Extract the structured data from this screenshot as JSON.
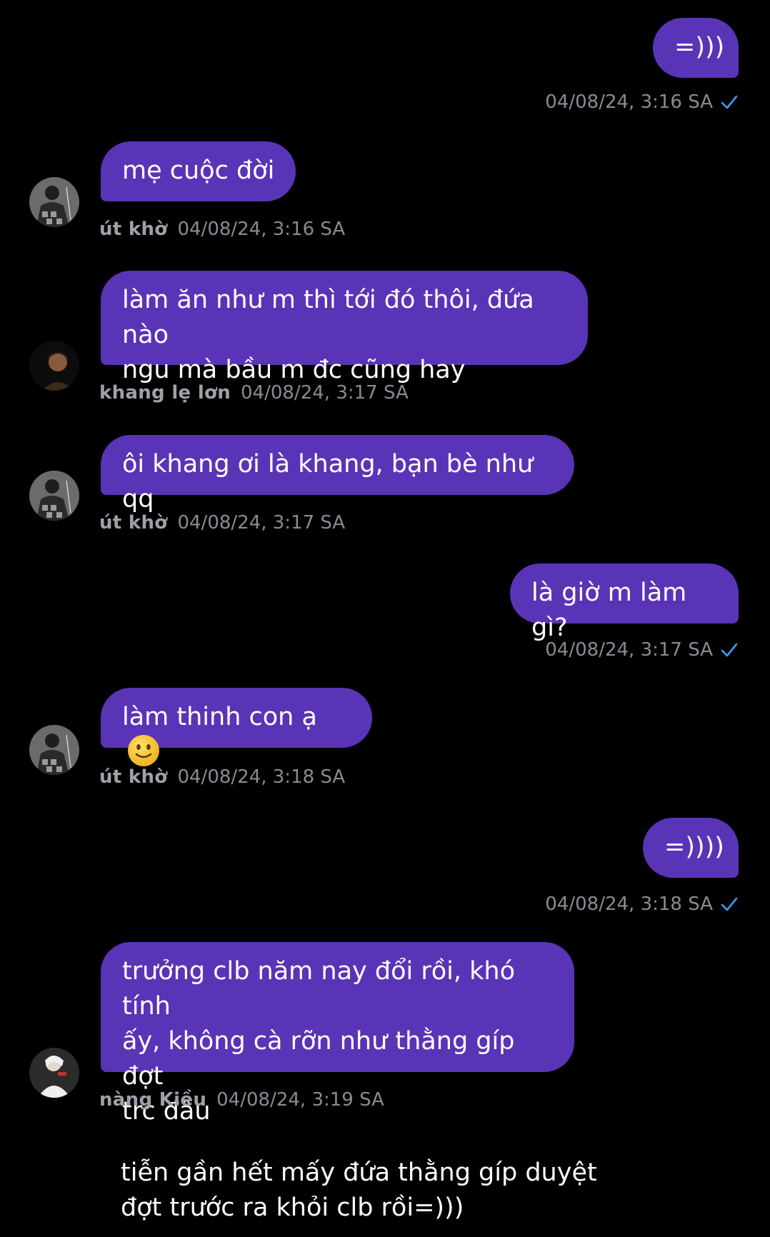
{
  "colors": {
    "background": "#000000",
    "bubble": "#5a34b6",
    "bubble_text": "#ffffff",
    "meta_text": "#8a8a93",
    "sender_text": "#a0a0a8",
    "checkmark": "#3b9cf0"
  },
  "messages": [
    {
      "direction": "out",
      "lines": [
        "=)))"
      ],
      "time": "04/08/24, 3:16 SA",
      "status_icon": "check-icon"
    },
    {
      "direction": "in",
      "sender": "út khờ",
      "avatar": "avatar-ut-kho",
      "lines": [
        "mẹ cuộc đời"
      ],
      "time": "04/08/24, 3:16 SA"
    },
    {
      "direction": "in",
      "sender": "khang lẹ lơn",
      "avatar": "avatar-khang",
      "lines": [
        "làm ăn như m thì tới đó thôi, đứa nào",
        "ngu mà bầu m đc cũng hay"
      ],
      "time": "04/08/24, 3:17 SA"
    },
    {
      "direction": "in",
      "sender": "út khờ",
      "avatar": "avatar-ut-kho",
      "lines": [
        "ôi khang ơi là khang, bạn bè như qq"
      ],
      "time": "04/08/24, 3:17 SA"
    },
    {
      "direction": "out",
      "lines": [
        "là giờ m làm gì?"
      ],
      "time": "04/08/24, 3:17 SA",
      "status_icon": "check-icon"
    },
    {
      "direction": "in",
      "sender": "út khờ",
      "avatar": "avatar-ut-kho",
      "lines": [
        "làm thinh con ạ"
      ],
      "emoji": "slightly-smiling-face-icon",
      "time": "04/08/24, 3:18 SA"
    },
    {
      "direction": "out",
      "lines": [
        "=))))"
      ],
      "time": "04/08/24, 3:18 SA",
      "status_icon": "check-icon"
    },
    {
      "direction": "in",
      "sender": "nàng Kiều",
      "avatar": "avatar-nang-kieu",
      "lines": [
        "trưởng clb năm nay đổi rồi, khó tính",
        "ấy, không cà rỡn như thằng gíp đợt",
        "trc đâu"
      ],
      "time": "04/08/24, 3:19 SA"
    },
    {
      "direction": "in-partial",
      "lines": [
        "tiễn gần hết mấy đứa thằng gíp duyệt",
        "đợt trước ra khỏi clb rồi=)))"
      ]
    }
  ]
}
